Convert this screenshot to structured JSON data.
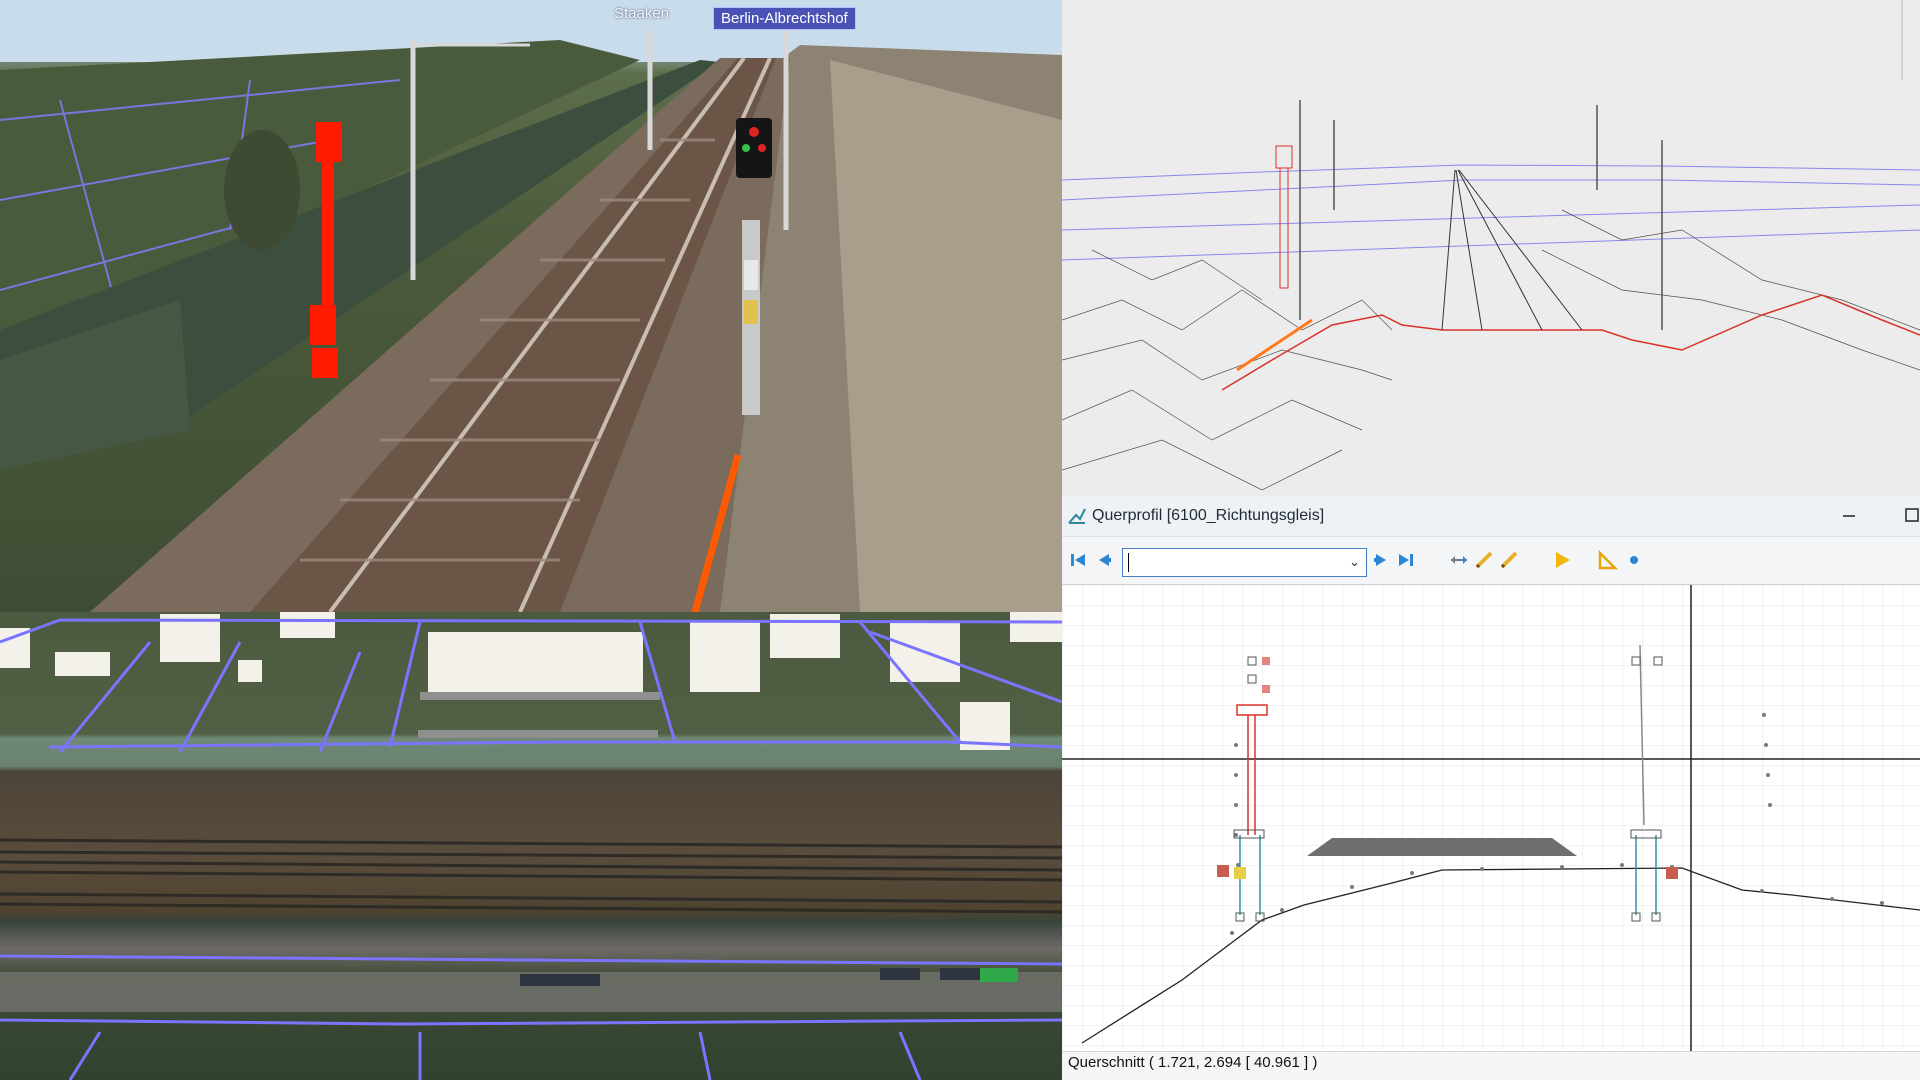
{
  "rail_view": {
    "place_labels": [
      "Staaken",
      "Berlin-Albrechtshof"
    ]
  },
  "querprofil": {
    "window_title": "Querprofil [6100_Richtungsgleis]",
    "track_select_value": "",
    "status_text": "Querschnitt   ( 1.721, 2.694 [ 40.961 ] )",
    "colors": {
      "accent_blue": "#2f86d6",
      "pencil_yellow": "#e6b12a",
      "signal_red": "#d9322b",
      "mast_cyan": "#2f93a8"
    },
    "toolbar_icons": [
      "first-icon",
      "previous-icon",
      "next-icon",
      "last-icon",
      "swap-icon",
      "pencil-icon",
      "pencil-alt-icon",
      "play-icon",
      "triangle-ruler-icon",
      "dot-icon"
    ]
  }
}
